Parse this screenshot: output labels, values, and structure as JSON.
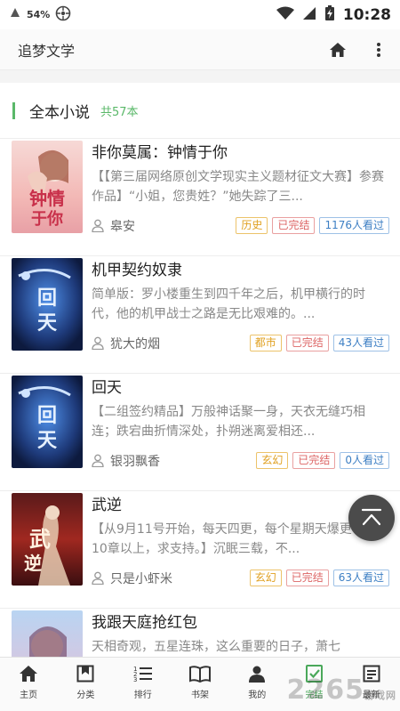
{
  "status_bar": {
    "signal_label": "4G",
    "battery_pct": "54%",
    "time": "10:28"
  },
  "app_bar": {
    "title": "追梦文学",
    "home_icon": "home-icon",
    "more_icon": "more-vert-icon"
  },
  "section": {
    "title": "全本小说",
    "count": "共57本"
  },
  "books": [
    {
      "title": "非你莫属：钟情于你",
      "description": "【【第三届网络原创文学现实主义题材征文大赛】参赛作品】“小姐，您贵姓？”她失踪了三...",
      "author": "皋安",
      "genre": "历史",
      "status": "已完结",
      "views": "1176人看过"
    },
    {
      "title": "机甲契约奴隶",
      "description": "简单版：罗小楼重生到四千年之后，机甲横行的时代，他的机甲战士之路是无比艰难的。...",
      "author": "犹大的烟",
      "genre": "都市",
      "status": "已完结",
      "views": "43人看过"
    },
    {
      "title": "回天",
      "description": "【二组签约精品】万般神话聚一身，天衣无缝巧相连；跌宕曲折情深处，扑朔迷离爱相还...",
      "author": "银羽飘香",
      "genre": "玄幻",
      "status": "已完结",
      "views": "0人看过"
    },
    {
      "title": "武逆",
      "description": "【从9月11号开始，每天四更，每个星期天爆更一次10章以上，求支持。】沉眠三载，不...",
      "author": "只是小虾米",
      "genre": "玄幻",
      "status": "已完结",
      "views": "63人看过"
    },
    {
      "title": "我跟天庭抢红包",
      "description": "天相奇观，五星连珠，这么重要的日子，萧七",
      "author": "",
      "genre": "",
      "status": "",
      "views": ""
    }
  ],
  "tabs": [
    {
      "label": "主页",
      "icon": "home-icon"
    },
    {
      "label": "分类",
      "icon": "category-icon"
    },
    {
      "label": "排行",
      "icon": "ranking-icon"
    },
    {
      "label": "书架",
      "icon": "bookshelf-icon"
    },
    {
      "label": "我的",
      "icon": "profile-icon"
    },
    {
      "label": "完结",
      "icon": "completed-icon",
      "active": true
    },
    {
      "label": "最新",
      "icon": "latest-icon"
    }
  ],
  "watermark": {
    "text": "2265",
    "sub": "游戏网"
  },
  "colors": {
    "accent": "#5ab869",
    "genre_tag": "#e0a020",
    "status_tag": "#dd6666",
    "views_tag": "#3d7fc4"
  }
}
